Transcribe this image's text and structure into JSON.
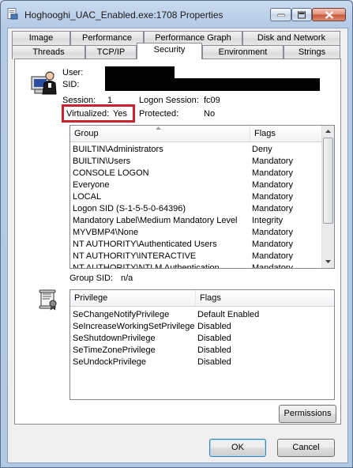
{
  "window": {
    "title": "Hoghooghi_UAC_Enabled.exe:1708 Properties"
  },
  "tabs": {
    "row1": [
      "Image",
      "Performance",
      "Performance Graph",
      "Disk and Network"
    ],
    "row2": [
      "Threads",
      "TCP/IP",
      "Security",
      "Environment",
      "Strings"
    ],
    "active": "Security"
  },
  "security": {
    "user_label": "User:",
    "sid_label": "SID:",
    "session_label": "Session:",
    "session_value": "1",
    "logon_session_label": "Logon Session:",
    "logon_session_value": "fc09",
    "virtualized_label": "Virtualized:",
    "virtualized_value": "Yes",
    "protected_label": "Protected:",
    "protected_value": "No",
    "group_sid_label": "Group SID:",
    "group_sid_value": "n/a"
  },
  "groups_table": {
    "columns": [
      "Group",
      "Flags"
    ],
    "rows": [
      {
        "group": "BUILTIN\\Administrators",
        "flags": "Deny"
      },
      {
        "group": "BUILTIN\\Users",
        "flags": "Mandatory"
      },
      {
        "group": "CONSOLE LOGON",
        "flags": "Mandatory"
      },
      {
        "group": "Everyone",
        "flags": "Mandatory"
      },
      {
        "group": "LOCAL",
        "flags": "Mandatory"
      },
      {
        "group": "Logon SID (S-1-5-5-0-64396)",
        "flags": "Mandatory"
      },
      {
        "group": "Mandatory Label\\Medium Mandatory Level",
        "flags": "Integrity"
      },
      {
        "group": "MYVBMP4\\None",
        "flags": "Mandatory"
      },
      {
        "group": "NT AUTHORITY\\Authenticated Users",
        "flags": "Mandatory"
      },
      {
        "group": "NT AUTHORITY\\INTERACTIVE",
        "flags": "Mandatory"
      },
      {
        "group": "NT AUTHORITY\\NTLM Authentication",
        "flags": "Mandatory"
      }
    ]
  },
  "privileges_table": {
    "columns": [
      "Privilege",
      "Flags"
    ],
    "rows": [
      {
        "privilege": "SeChangeNotifyPrivilege",
        "flags": "Default Enabled"
      },
      {
        "privilege": "SeIncreaseWorkingSetPrivilege",
        "flags": "Disabled"
      },
      {
        "privilege": "SeShutdownPrivilege",
        "flags": "Disabled"
      },
      {
        "privilege": "SeTimeZonePrivilege",
        "flags": "Disabled"
      },
      {
        "privilege": "SeUndockPrivilege",
        "flags": "Disabled"
      }
    ]
  },
  "buttons": {
    "permissions": "Permissions",
    "ok": "OK",
    "cancel": "Cancel"
  },
  "colors": {
    "highlight_box": "#c8232c",
    "window_frame": "#b6cbe6"
  },
  "icons": [
    "app-exe-icon",
    "user-computer-icon",
    "privilege-scroll-icon",
    "minimize-icon",
    "maximize-icon",
    "close-icon",
    "sort-ascending-icon",
    "scroll-up-icon",
    "scroll-down-icon"
  ]
}
